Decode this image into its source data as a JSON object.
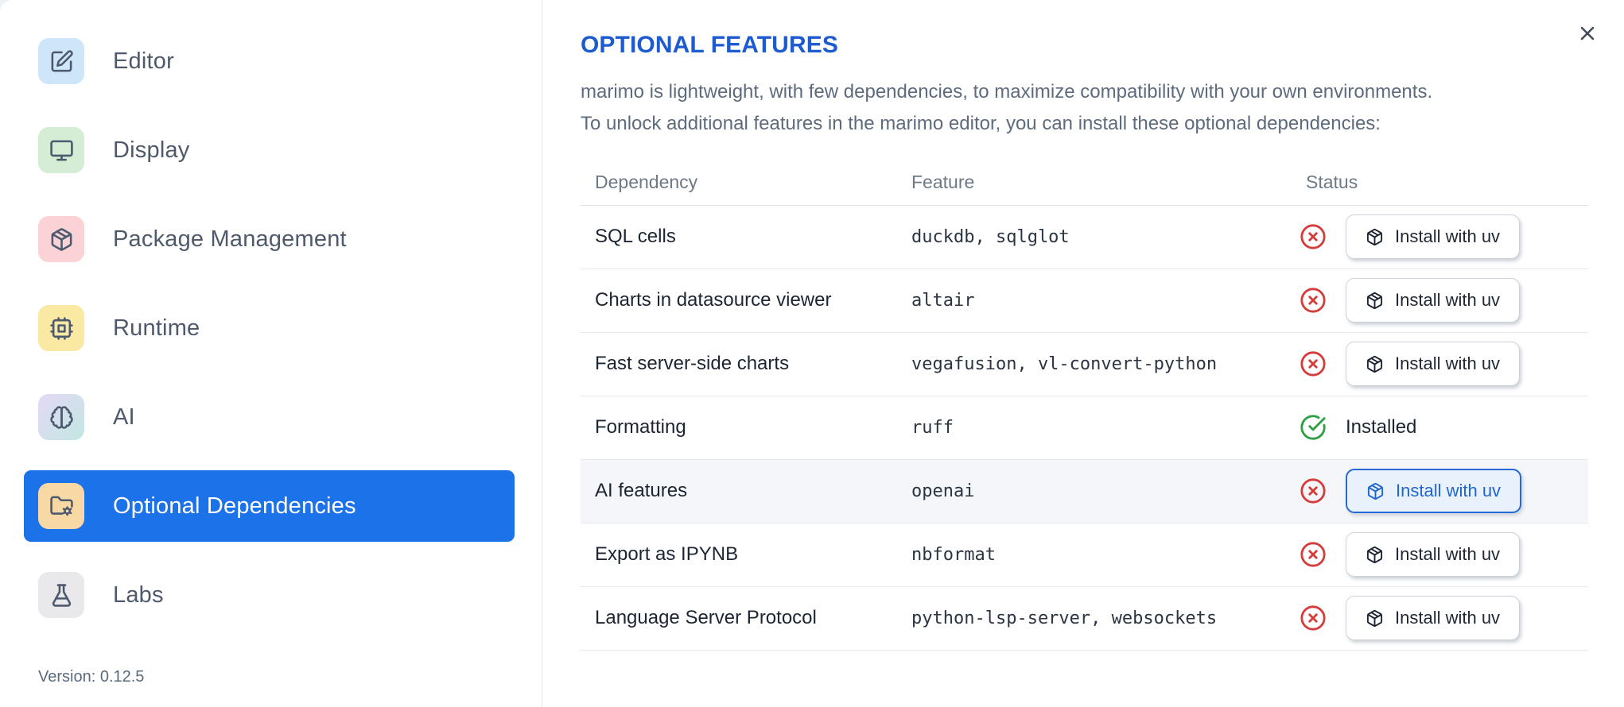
{
  "sidebar": {
    "items": [
      {
        "label": "Editor",
        "icon": "pen-square-icon",
        "tile_color": "#cfe5fa",
        "selected": false
      },
      {
        "label": "Display",
        "icon": "monitor-icon",
        "tile_color": "#d5ecd5",
        "selected": false
      },
      {
        "label": "Package Management",
        "icon": "package-icon",
        "tile_color": "#fbd3d6",
        "selected": false
      },
      {
        "label": "Runtime",
        "icon": "cpu-icon",
        "tile_color": "#fae9a2",
        "selected": false
      },
      {
        "label": "AI",
        "icon": "brain-icon",
        "tile_color": "gradient #e5d8f6 to #c2e7e2",
        "selected": false
      },
      {
        "label": "Optional Dependencies",
        "icon": "folder-cog-icon",
        "tile_color": "#f8d8a4",
        "selected": true
      },
      {
        "label": "Labs",
        "icon": "flask-icon",
        "tile_color": "#e9e9ec",
        "selected": false
      }
    ],
    "version": "Version: 0.12.5"
  },
  "main": {
    "title": "OPTIONAL FEATURES",
    "description_line1": "marimo is lightweight, with few dependencies, to maximize compatibility with your own environments.",
    "description_line2": "To unlock additional features in the marimo editor, you can install these optional dependencies:",
    "table": {
      "headers": {
        "dependency": "Dependency",
        "feature": "Feature",
        "status": "Status"
      },
      "rows": [
        {
          "dependency": "SQL cells",
          "feature": "duckdb, sqlglot",
          "installed": false,
          "action": "Install with uv",
          "highlighted": false
        },
        {
          "dependency": "Charts in datasource viewer",
          "feature": "altair",
          "installed": false,
          "action": "Install with uv",
          "highlighted": false
        },
        {
          "dependency": "Fast server-side charts",
          "feature": "vegafusion, vl-convert-python",
          "installed": false,
          "action": "Install with uv",
          "highlighted": false
        },
        {
          "dependency": "Formatting",
          "feature": "ruff",
          "installed": true,
          "status_text": "Installed",
          "highlighted": false
        },
        {
          "dependency": "AI features",
          "feature": "openai",
          "installed": false,
          "action": "Install with uv",
          "highlighted": true
        },
        {
          "dependency": "Export as IPYNB",
          "feature": "nbformat",
          "installed": false,
          "action": "Install with uv",
          "highlighted": false
        },
        {
          "dependency": "Language Server Protocol",
          "feature": "python-lsp-server, websockets",
          "installed": false,
          "action": "Install with uv",
          "highlighted": false
        }
      ]
    }
  },
  "colors": {
    "sidebar_selected_bg": "#1c72e8",
    "title_blue": "#1d5bd0",
    "focused_button_border": "#2669d2",
    "focused_button_bg": "#e8f1fc",
    "error_red": "#d53d3d",
    "success_green": "#2f9e44"
  }
}
